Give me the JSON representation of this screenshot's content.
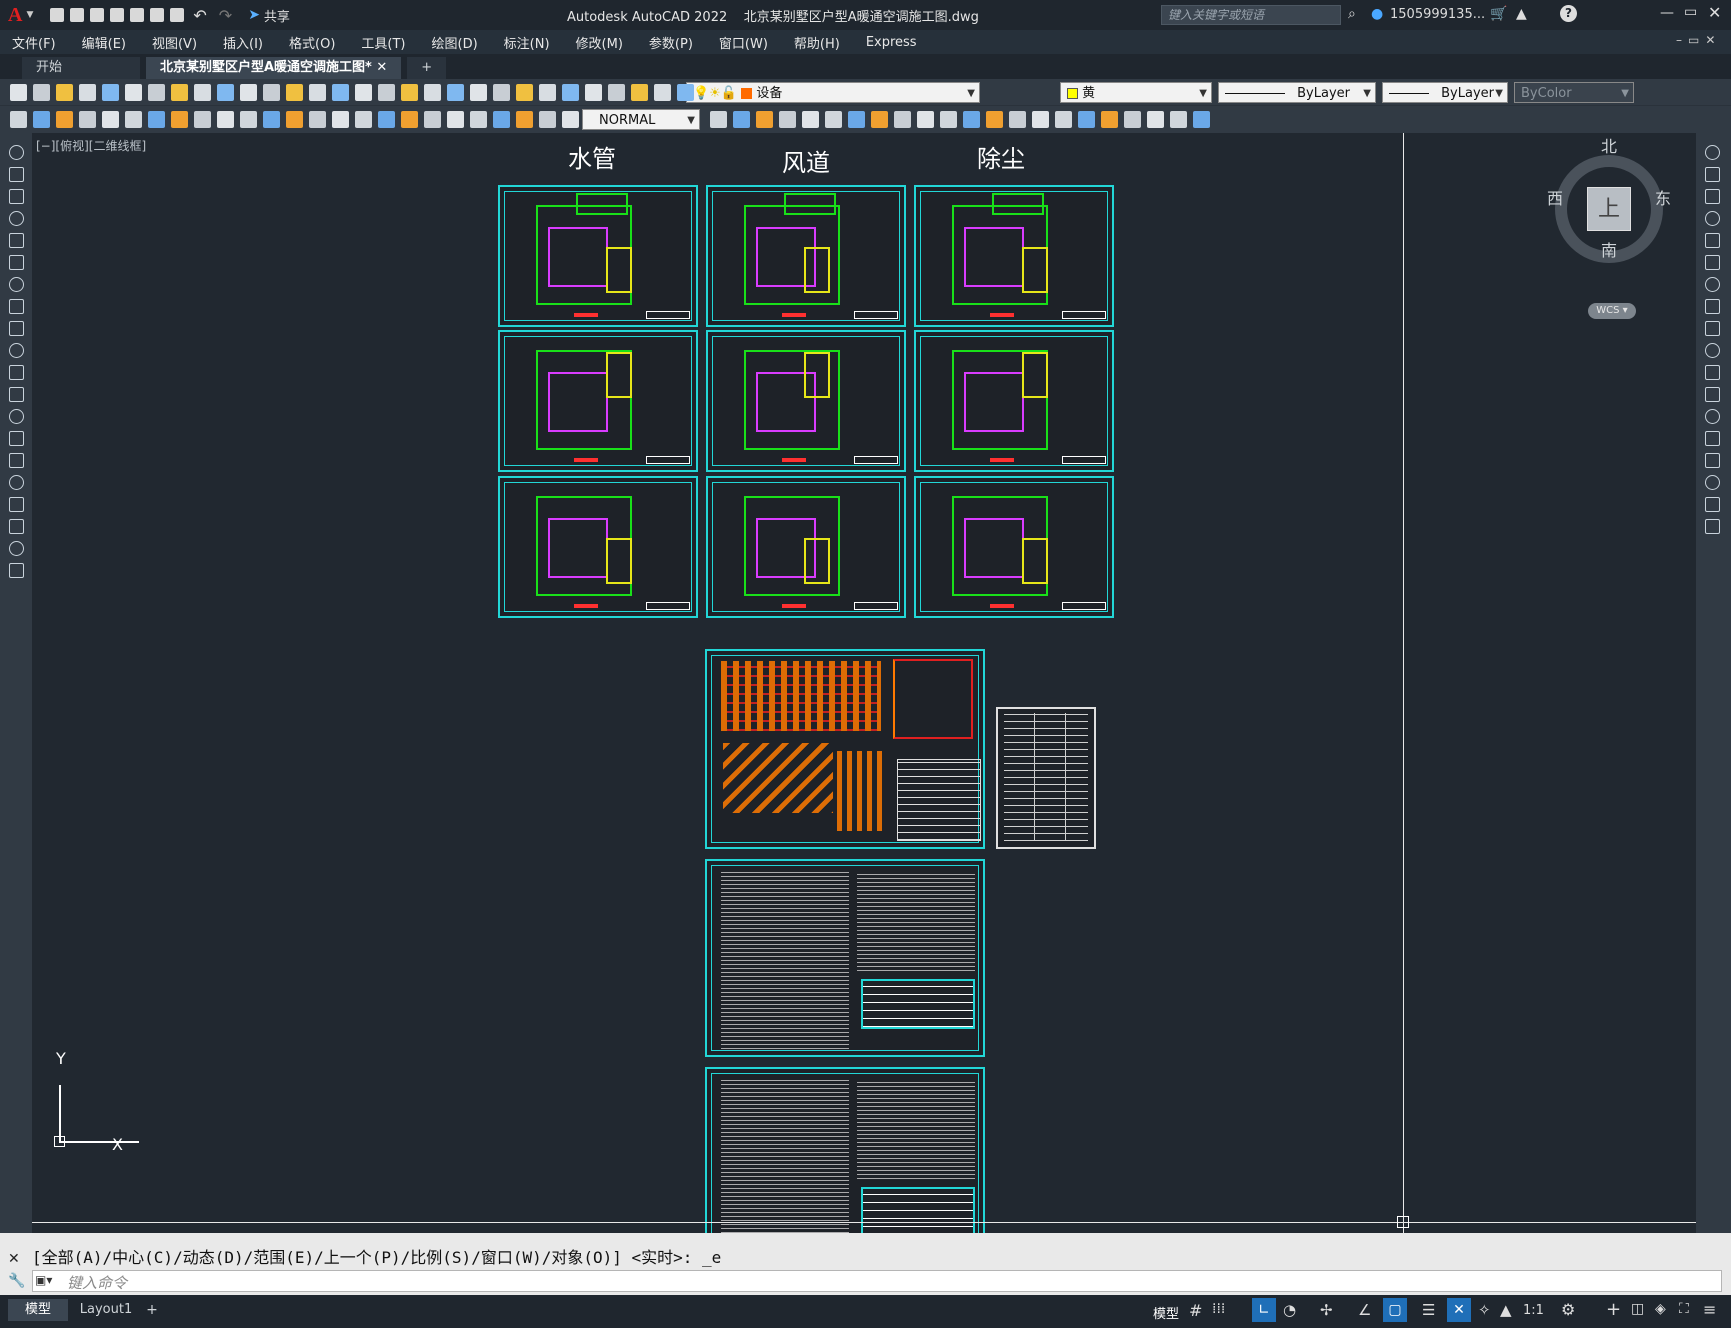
{
  "app": {
    "title": "Autodesk AutoCAD 2022    北京某别墅区户型A暖通空调施工图.dwg",
    "logo": "A",
    "share_label": "共享",
    "search_placeholder": "键入关键字或短语",
    "user": "1505999135...",
    "window_controls": [
      "minimize-icon",
      "maximize-icon",
      "close-icon"
    ]
  },
  "menubar": {
    "items": [
      "文件(F)",
      "编辑(E)",
      "视图(V)",
      "插入(I)",
      "格式(O)",
      "工具(T)",
      "绘图(D)",
      "标注(N)",
      "修改(M)",
      "参数(P)",
      "窗口(W)",
      "帮助(H)",
      "Express"
    ]
  },
  "tabs": [
    {
      "label": "开始",
      "active": false
    },
    {
      "label": "北京某别墅区户型A暖通空调施工图*",
      "active": true
    },
    {
      "label": "+",
      "active": false
    }
  ],
  "toolbar": {
    "layer_value": "设备",
    "color_value": "黄",
    "linetype_value": "ByLayer",
    "lineweight_value": "ByLayer",
    "plotstyle_value": "ByColor",
    "style_value": "NORMAL"
  },
  "viewport": {
    "label": "[−][俯视][二维线框]",
    "column_titles": [
      "水管",
      "风道",
      "除尘"
    ],
    "compass": {
      "north": "北",
      "south": "南",
      "east": "东",
      "west": "西",
      "center": "上",
      "wcs": "WCS"
    },
    "ucs": {
      "x": "X",
      "y": "Y"
    }
  },
  "command": {
    "history": "[全部(A)/中心(C)/动态(D)/范围(E)/上一个(P)/比例(S)/窗口(W)/对象(O)] <实时>: _e",
    "input_placeholder": "键入命令"
  },
  "status": {
    "layout_tabs": [
      "模型",
      "Layout1",
      "+"
    ],
    "model_label": "模型",
    "scale": "1:1"
  },
  "colors": {
    "sheet_border": "#22d7d7",
    "plan_green": "#19e019",
    "plan_yellow": "#e6e619",
    "plan_magenta": "#d93cff",
    "plan_red": "#ff3030",
    "background": "#212830"
  }
}
